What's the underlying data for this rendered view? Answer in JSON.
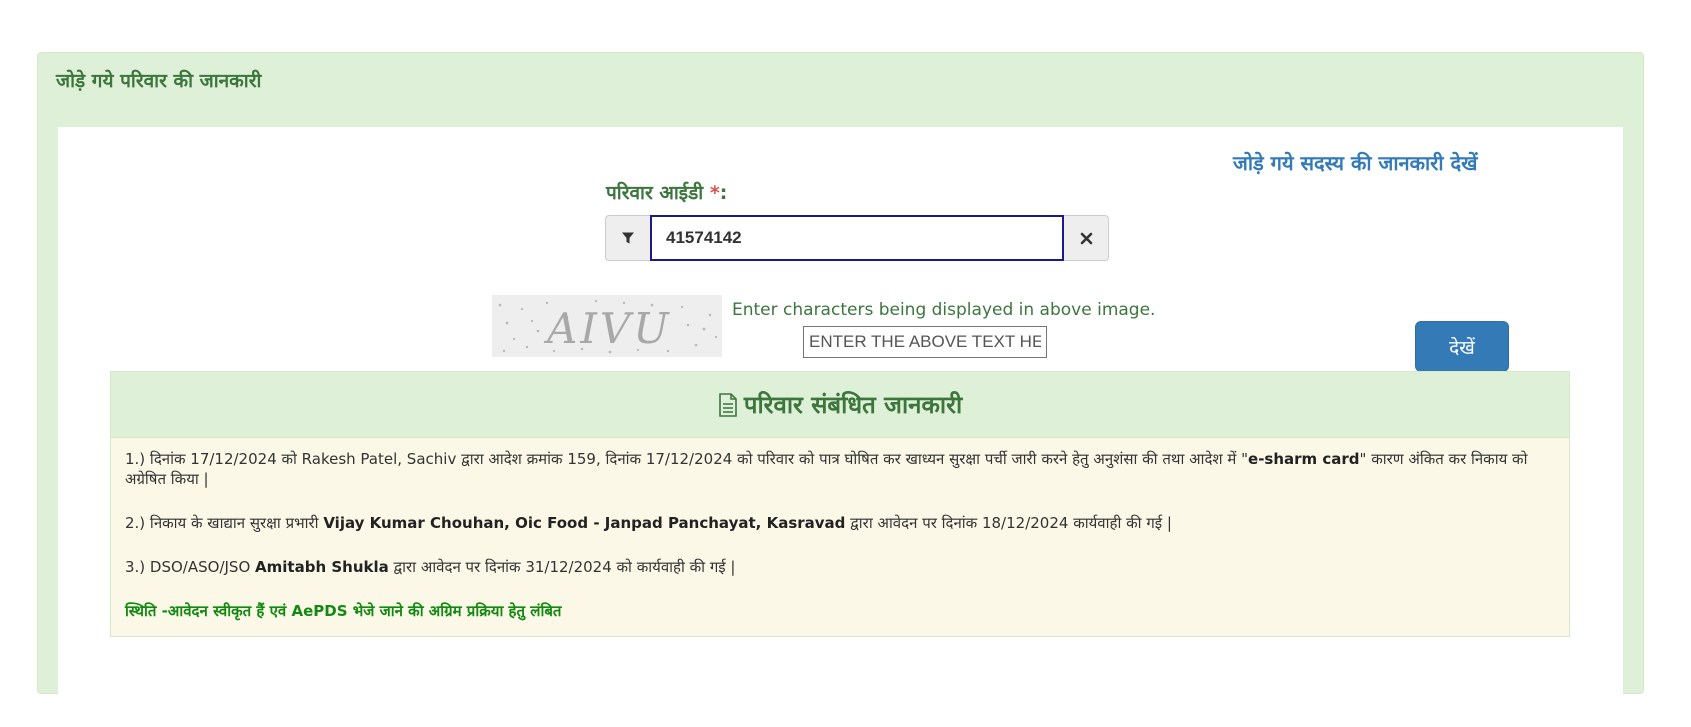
{
  "panel": {
    "heading": "जोड़े गये परिवार की जानकारी"
  },
  "link": {
    "view_members": "जोड़े गये सदस्य की जानकारी देखें"
  },
  "form": {
    "family_id_label": "परिवार आईडी ",
    "required_mark": "*",
    "label_colon": ":",
    "family_id_value": "41574142",
    "captcha_text": "AIVU",
    "captcha_hint": "Enter characters being displayed in above image.",
    "captcha_placeholder": "ENTER THE ABOVE TEXT HERE",
    "submit_label": "देखें"
  },
  "info": {
    "title": "परिवार संबंधित जानकारी",
    "line1": {
      "a": "1.) दिनांक 17/12/2024 को Rakesh Patel, Sachiv द्वारा आदेश क्रमांक 159, दिनांक 17/12/2024 को परिवार को पात्र घोषित कर खाध्यन सुरक्षा पर्ची जारी करने हेतु अनुशंसा की तथा आदेश में \"",
      "b": "e-sharm card",
      "c": "\" कारण अंकित कर निकाय को अग्रेषित किया |"
    },
    "line2": {
      "a": "2.) निकाय के खाद्यान सुरक्षा प्रभारी ",
      "b": "Vijay Kumar Chouhan, Oic Food - Janpad Panchayat, Kasravad",
      "c": " द्वारा आवेदन पर दिनांक 18/12/2024 कार्यवाही की गई |"
    },
    "line3": {
      "a": "3.) DSO/ASO/JSO ",
      "b": "Amitabh Shukla",
      "c": " द्वारा आवेदन पर दिनांक 31/12/2024 को कार्यवाही की गई |"
    },
    "status": "स्थिति -आवेदन स्वीकृत हैं एवं AePDS भेजे जाने की अग्रिम प्रक्रिया हेतु लंबित"
  },
  "icons": {
    "filter": "filter-icon",
    "clear": "close-icon",
    "document": "document-icon"
  },
  "colors": {
    "panel_bg": "#dff0d8",
    "heading_green": "#3c763d",
    "link_blue": "#337ab7",
    "button_blue": "#337ab7",
    "info_bg": "#fcf8e8",
    "status_green": "#128a12"
  }
}
